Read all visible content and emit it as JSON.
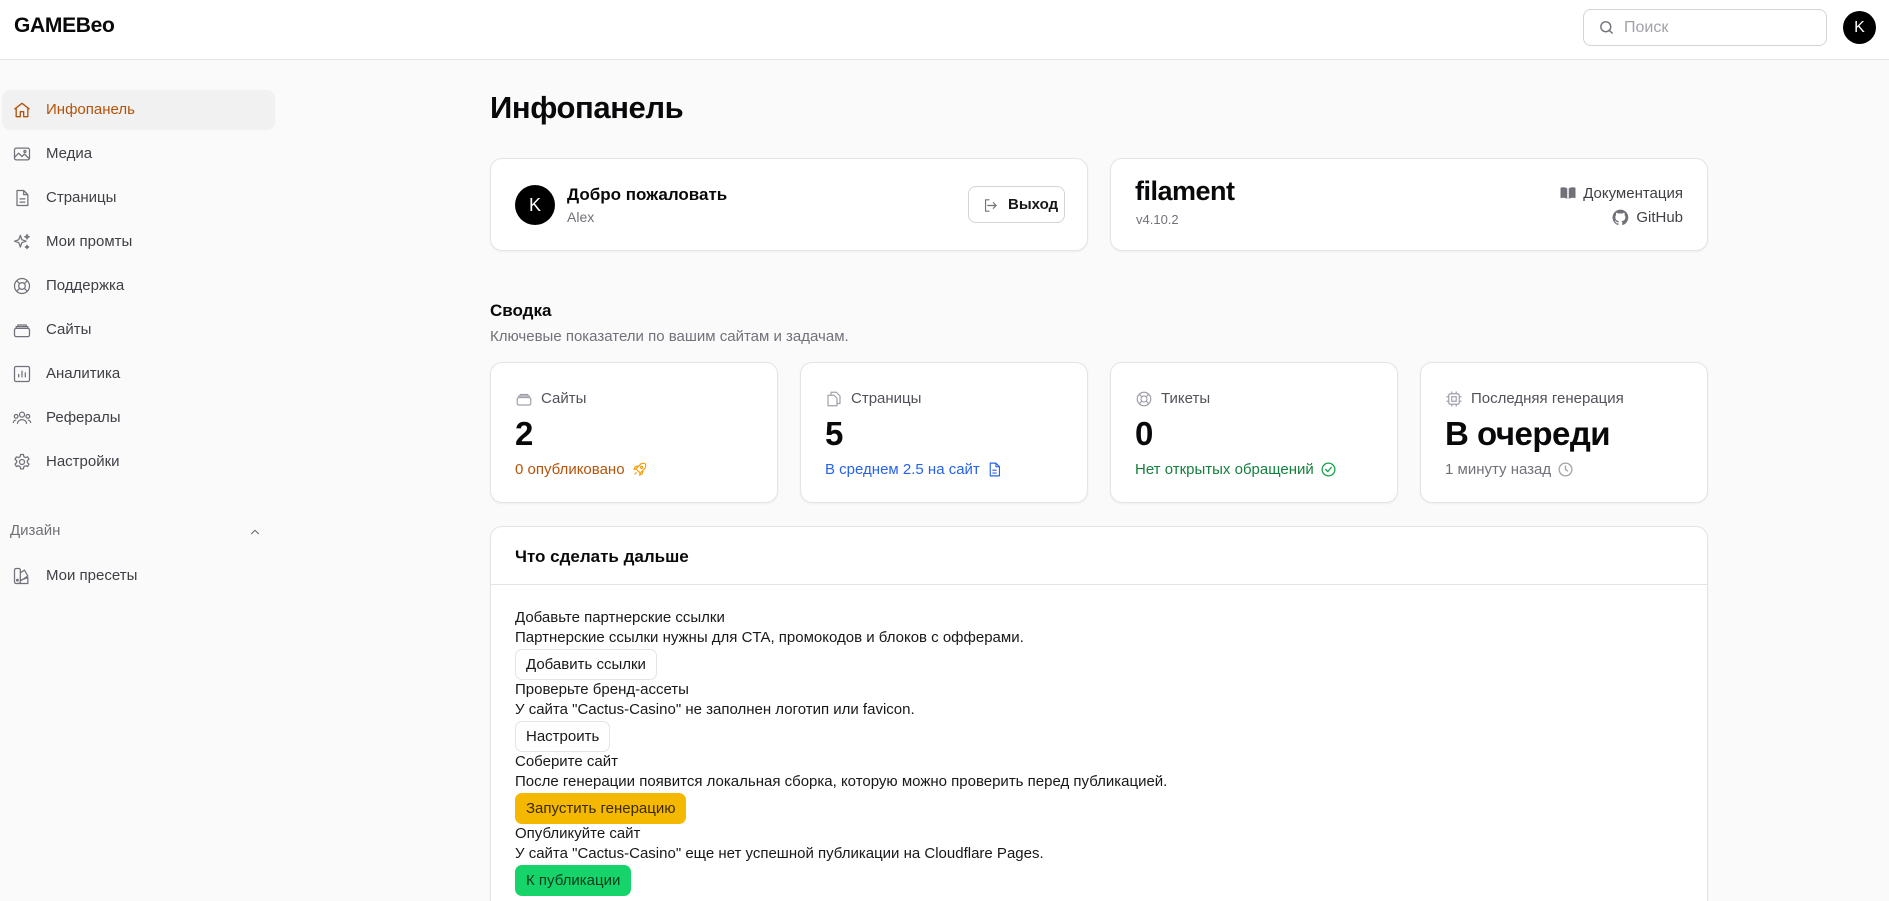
{
  "app": {
    "brand": "GAMEBeo",
    "avatar_initial": "K"
  },
  "search": {
    "placeholder": "Поиск"
  },
  "sidebar": {
    "items": [
      {
        "label": "Инфопанель",
        "icon": "home-icon",
        "active": true
      },
      {
        "label": "Медиа",
        "icon": "image-icon"
      },
      {
        "label": "Страницы",
        "icon": "document-icon"
      },
      {
        "label": "Мои промты",
        "icon": "sparkles-icon"
      },
      {
        "label": "Поддержка",
        "icon": "lifebuoy-icon"
      },
      {
        "label": "Сайты",
        "icon": "stack-icon"
      },
      {
        "label": "Аналитика",
        "icon": "chart-bar-icon"
      },
      {
        "label": "Рефералы",
        "icon": "users-icon"
      },
      {
        "label": "Настройки",
        "icon": "gear-icon"
      }
    ],
    "group": {
      "label": "Дизайн",
      "icon": "chevron-up-icon"
    },
    "group_items": [
      {
        "label": "Мои пресеты",
        "icon": "swatch-icon"
      }
    ]
  },
  "page": {
    "title": "Инфопанель"
  },
  "welcome": {
    "avatar_initial": "K",
    "title": "Добро пожаловать",
    "user": "Alex",
    "logout_label": "Выход"
  },
  "filament": {
    "logo": "filament",
    "version": "v4.10.2",
    "docs_label": "Документация",
    "github_label": "GitHub"
  },
  "summary": {
    "title": "Сводка",
    "description": "Ключевые показатели по вашим сайтам и задачам.",
    "stats": [
      {
        "label": "Сайты",
        "value": "2",
        "desc": "0 опубликовано",
        "icon": "stack-icon",
        "desc_icon": "rocket-icon",
        "color": "#b45309"
      },
      {
        "label": "Страницы",
        "value": "5",
        "desc": "В среднем 2.5 на сайт",
        "icon": "documents-icon",
        "desc_icon": "document-text-icon",
        "color": "#2563eb"
      },
      {
        "label": "Тикеты",
        "value": "0",
        "desc": "Нет открытых обращений",
        "icon": "lifebuoy-icon",
        "desc_icon": "check-circle-icon",
        "color": "#15803d"
      },
      {
        "label": "Последняя генерация",
        "value": "В очереди",
        "desc": "1 минуту назад",
        "icon": "cpu-icon",
        "desc_icon": "clock-icon",
        "color": "#71717a"
      }
    ]
  },
  "next": {
    "title": "Что сделать дальше",
    "tasks": [
      {
        "title": "Добавьте партнерские ссылки",
        "desc": "Партнерские ссылки нужны для CTA, промокодов и блоков с офферами.",
        "action": "Добавить ссылки",
        "style": "plain"
      },
      {
        "title": "Проверьте бренд-ассеты",
        "desc": "У сайта \"Cactus-Casino\" не заполнен логотип или favicon.",
        "action": "Настроить",
        "style": "plain"
      },
      {
        "title": "Соберите сайт",
        "desc": "После генерации появится локальная сборка, которую можно проверить перед публикацией.",
        "action": "Запустить генерацию",
        "style": "amber"
      },
      {
        "title": "Опубликуйте сайт",
        "desc": "У сайта \"Cactus-Casino\" еще нет успешной публикации на Cloudflare Pages.",
        "action": "К публикации",
        "style": "green"
      }
    ]
  },
  "colors": {
    "accent": "#b45309",
    "amber": "#f5b800",
    "green": "#16d36a"
  }
}
